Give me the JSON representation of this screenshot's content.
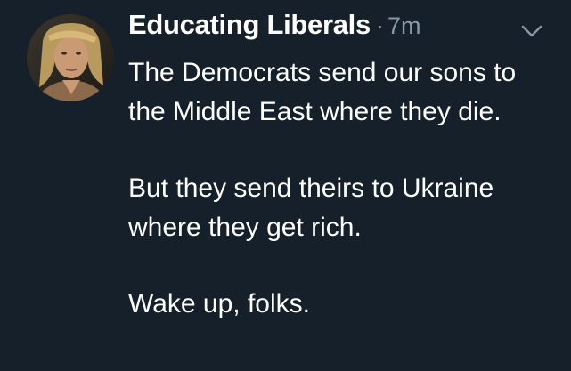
{
  "tweet": {
    "display_name": "Educating Liberals",
    "separator": "·",
    "time": "7m",
    "paragraphs": [
      "The Democrats send our sons to the Middle East where they die.",
      "But they send theirs to Ukraine where they get rich.",
      "Wake up, folks."
    ]
  },
  "icons": {
    "avatar": "profile-photo-avatar",
    "menu": "chevron-down-icon"
  },
  "colors": {
    "background": "#15202b",
    "primary_text": "#ffffff",
    "secondary_text": "#8899a6"
  }
}
